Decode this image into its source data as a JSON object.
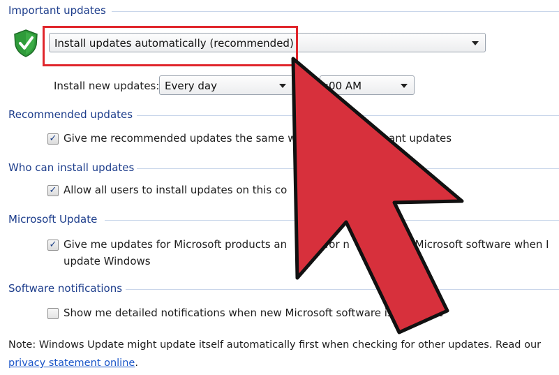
{
  "important_updates": {
    "title": "Important updates",
    "mode_value": "Install updates automatically (recommended)",
    "install_new_label": "Install new updates:",
    "frequency_value": "Every day",
    "time_value": ":00 AM"
  },
  "recommended_updates": {
    "title": "Recommended updates",
    "option_label": "Give me recommended updates the same w",
    "option_label_tail": "ant updates",
    "checked": true
  },
  "who_can_install": {
    "title": "Who can install updates",
    "option_label": "Allow all users to install updates on this co",
    "checked": true
  },
  "microsoft_update": {
    "title": "Microsoft Update",
    "option_label_a": "Give me updates for Microsoft products an",
    "option_label_b": "for n",
    "option_label_c": "nal Microsoft software when I",
    "option_label_line2": "update Windows",
    "checked": true
  },
  "software_notifications": {
    "title": "Software notifications",
    "option_label": "Show me detailed notifications when new Microsoft software is available",
    "checked": false
  },
  "note": {
    "line1": "Note: Windows Update might update itself automatically first when checking for other updates.  Read our",
    "link": "privacy statement online",
    "link_suffix": "."
  },
  "colors": {
    "section_title": "#1e3e8c",
    "highlight_box": "#e0262c",
    "arrow_fill": "#d7303c",
    "link": "#1a55c8"
  },
  "icons": {
    "shield": "shield-check-icon",
    "pointer": "red-arrow-pointer-icon"
  }
}
